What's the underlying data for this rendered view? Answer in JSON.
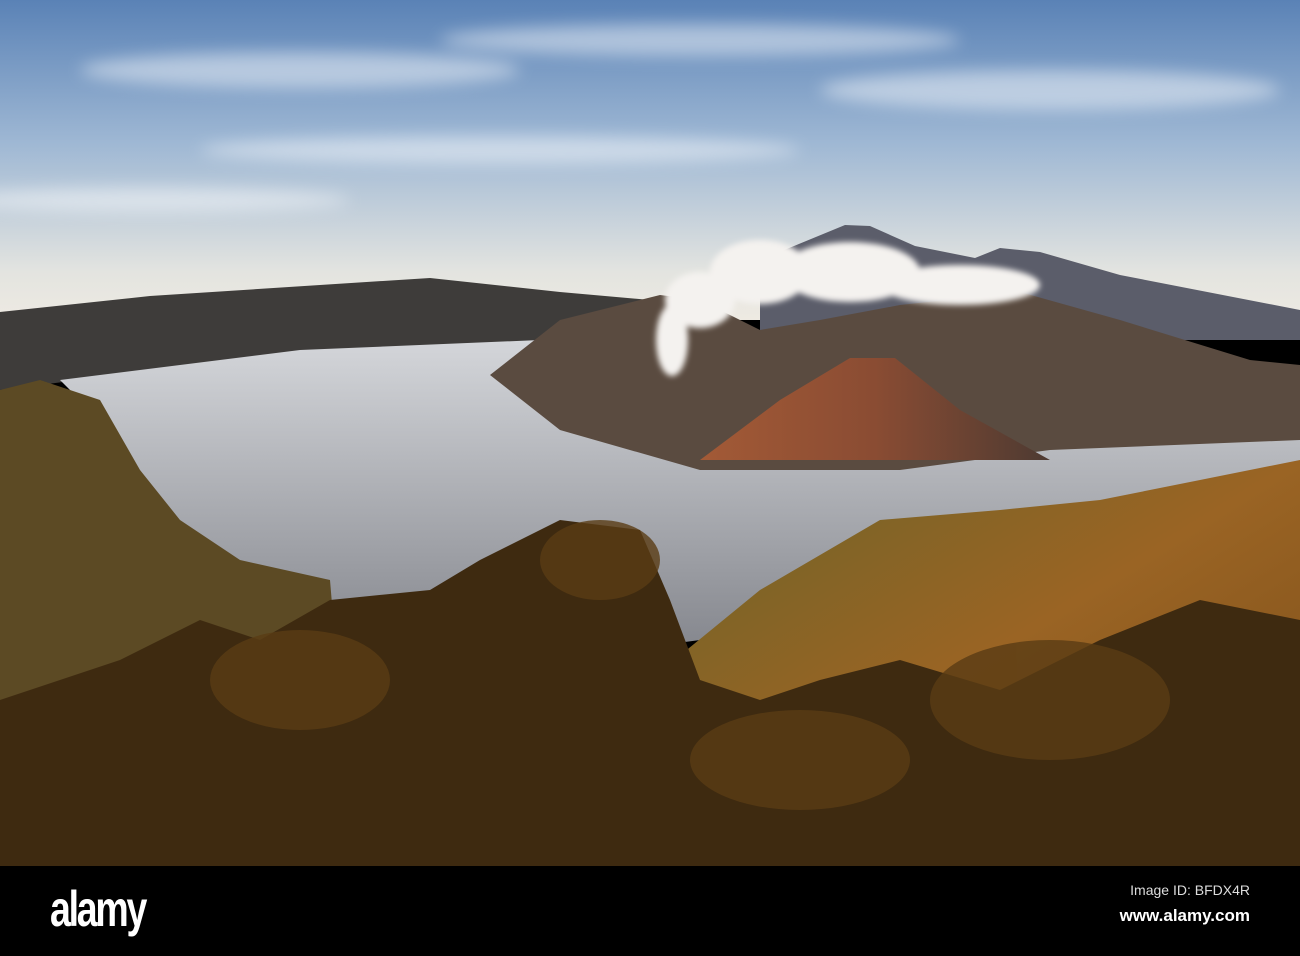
{
  "watermark": {
    "logo": "alamy",
    "image_id": "Image ID: BFDX4R",
    "url": "www.alamy.com"
  },
  "colors": {
    "sky_top": "#5f86b8",
    "sky_horizon": "#e6e6e0",
    "fog": "#c9ccd2",
    "forest": "#6b4a1c",
    "bar": "#000000"
  }
}
